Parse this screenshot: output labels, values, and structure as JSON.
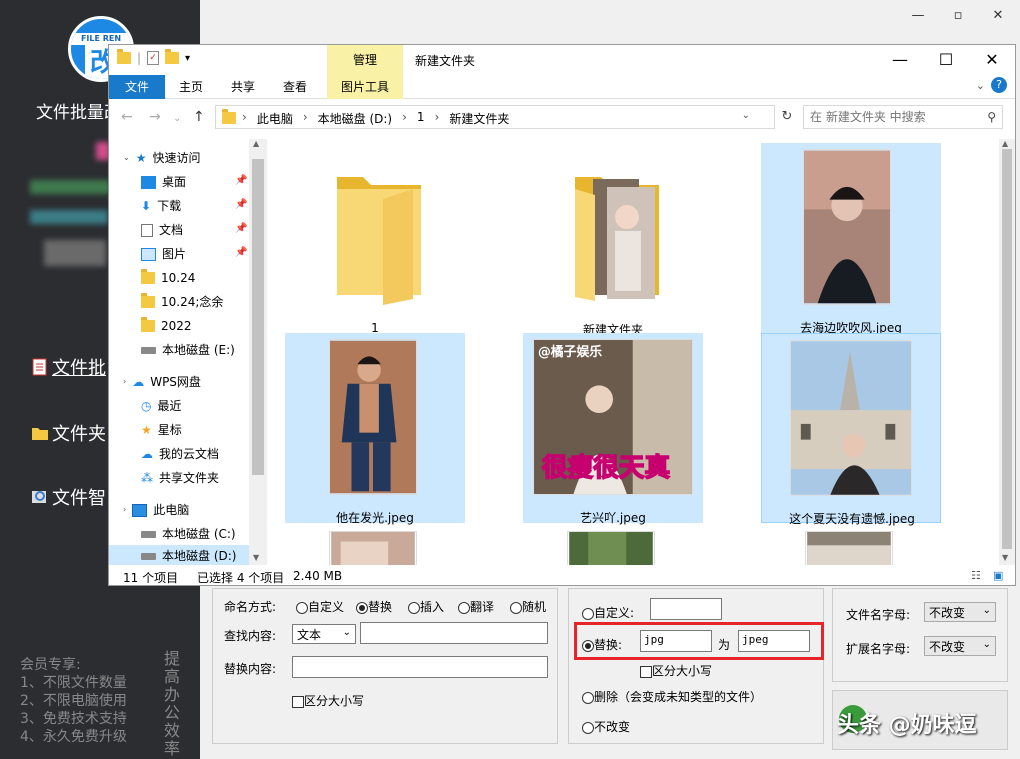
{
  "app": {
    "title": "文件批量改",
    "nav": [
      "文件批",
      "文件夹",
      "文件智"
    ],
    "member_title": "会员专享:",
    "member_items": [
      "1、不限文件数量",
      "2、不限电脑使用",
      "3、免费技术支持",
      "4、永久免费升级"
    ],
    "vertical_text": "提高办公效率",
    "logo_text": "FILE REN"
  },
  "explorer": {
    "manage_tab": "管理",
    "title": "新建文件夹",
    "ribbon_tabs": [
      "文件",
      "主页",
      "共享",
      "查看",
      "图片工具"
    ],
    "breadcrumbs": [
      "此电脑",
      "本地磁盘 (D:)",
      "1",
      "新建文件夹"
    ],
    "search_placeholder": "在 新建文件夹 中搜索",
    "nav_items": [
      {
        "label": "快速访问",
        "icon": "star-icon",
        "pinned": false
      },
      {
        "label": "桌面",
        "icon": "desktop-icon",
        "pinned": true
      },
      {
        "label": "下载",
        "icon": "download-icon",
        "pinned": true
      },
      {
        "label": "文档",
        "icon": "document-icon",
        "pinned": true
      },
      {
        "label": "图片",
        "icon": "picture-icon",
        "pinned": true
      },
      {
        "label": "10.24",
        "icon": "folder-icon",
        "pinned": false
      },
      {
        "label": "10.24;念余",
        "icon": "folder-icon",
        "pinned": false
      },
      {
        "label": "2022",
        "icon": "folder-icon",
        "pinned": false
      },
      {
        "label": "本地磁盘 (E:)",
        "icon": "drive-icon",
        "pinned": false
      },
      {
        "label": "WPS网盘",
        "icon": "cloud-icon",
        "pinned": false
      },
      {
        "label": "最近",
        "icon": "clock-icon",
        "pinned": false
      },
      {
        "label": "星标",
        "icon": "star-icon",
        "pinned": false
      },
      {
        "label": "我的云文档",
        "icon": "cloud-icon",
        "pinned": false
      },
      {
        "label": "共享文件夹",
        "icon": "share-icon",
        "pinned": false
      },
      {
        "label": "此电脑",
        "icon": "computer-icon",
        "pinned": false
      },
      {
        "label": "本地磁盘 (C:)",
        "icon": "drive-icon",
        "pinned": false
      },
      {
        "label": "本地磁盘 (D:)",
        "icon": "drive-icon",
        "pinned": false
      }
    ],
    "files": [
      {
        "name": "1",
        "type": "folder"
      },
      {
        "name": "新建文件夹",
        "type": "folder"
      },
      {
        "name": "去海边吹吹风.jpeg",
        "type": "image"
      },
      {
        "name": "他在发光.jpeg",
        "type": "image"
      },
      {
        "name": "艺兴吖.jpeg",
        "type": "image"
      },
      {
        "name": "这个夏天没有遗憾.jpeg",
        "type": "image"
      }
    ],
    "photo_caption": "很瘦很天真",
    "photo_watermark": "@橘子娱乐",
    "status_count": "11 个项目",
    "status_selected": "已选择 4 个项目",
    "status_size": "2.40 MB"
  },
  "rename": {
    "mode_label": "命名方式:",
    "modes": [
      "自定义",
      "替换",
      "插入",
      "翻译",
      "随机"
    ],
    "find_label": "查找内容:",
    "find_type": "文本",
    "replace_label": "替换内容:",
    "case_label": "区分大小写",
    "ext_custom": "自定义:",
    "ext_replace": "替换:",
    "ext_from": "jpg",
    "ext_to_label": "为",
    "ext_to": "jpeg",
    "ext_case": "区分大小写",
    "ext_delete": "删除（会变成未知类型的文件）",
    "ext_keep": "不改变",
    "name_case_label": "文件名字母:",
    "name_case_value": "不改变",
    "ext_case_label": "扩展名字母:",
    "ext_case_value": "不改变",
    "watermark": "头条 @奶味逗"
  }
}
